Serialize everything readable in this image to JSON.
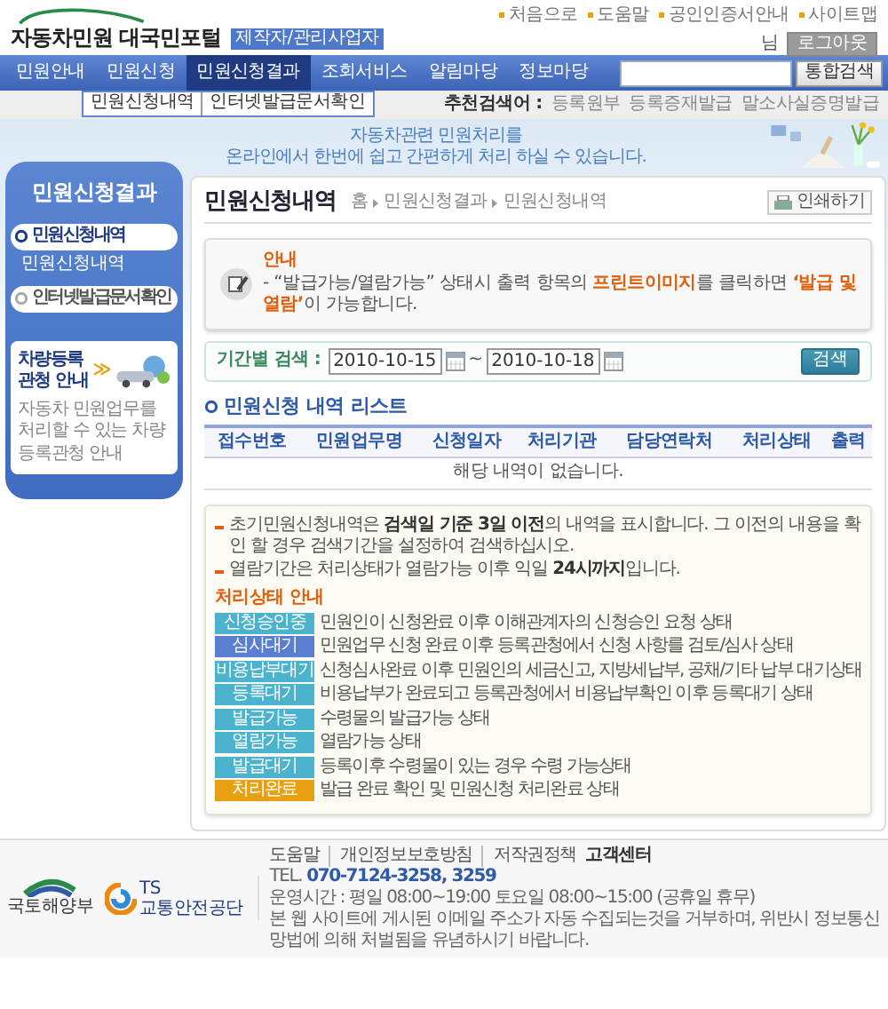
{
  "header": {
    "logo": "자동차민원 대국민포털",
    "logo_badge": "제작자/관리사업자",
    "top_links": [
      "처음으로",
      "도움말",
      "공인인증서안내",
      "사이트맵"
    ],
    "user_suffix": "님",
    "logout_button": "로그아웃"
  },
  "nav": {
    "tabs": [
      {
        "label": "민원안내",
        "selected": false
      },
      {
        "label": "민원신청",
        "selected": false
      },
      {
        "label": "민원신청결과",
        "selected": true
      },
      {
        "label": "조회서비스",
        "selected": false
      },
      {
        "label": "알림마당",
        "selected": false
      },
      {
        "label": "정보마당",
        "selected": false
      }
    ],
    "search_button": "통합검색"
  },
  "submenu": [
    "민원신청내역",
    "인터넷발급문서확인"
  ],
  "recommended": {
    "label": "추천검색어 :",
    "terms": [
      "등록원부",
      "등록증재발급",
      "말소사실증명발급"
    ]
  },
  "banner": {
    "lines": [
      "자동차관련 민원처리를",
      "온라인에서 한번에 쉽고 간편하게 처리 하실 수 있습니다."
    ]
  },
  "sidebar": {
    "title": "민원신청결과",
    "items": [
      {
        "label": "민원신청내역",
        "selected": true,
        "expanded": true,
        "children": [
          {
            "label": "민원신청내역",
            "selected": true
          }
        ]
      },
      {
        "label": "인터넷발급문서확인",
        "selected": false,
        "expanded": false
      }
    ],
    "ad": {
      "title": "차량등록 관청 안내",
      "arrow": "≫",
      "text": "자동차 민원업무를 처리할 수 있는 차량등록관청 안내"
    }
  },
  "content": {
    "title": "민원신청내역",
    "breadcrumb": [
      "홈",
      "민원신청결과",
      "민원신청내역"
    ],
    "print_button": "인쇄하기",
    "notice": {
      "title": "안내",
      "text": "- “발급가능/열람가능” 상태시 출력 항목의 **프린트이미지**를 클릭하면 **‘발급 및 열람’**이 가능합니다."
    },
    "search": {
      "label": "기간별 검색 :",
      "date_from": "2010-10-15",
      "separator": "~",
      "date_to": "2010-10-18",
      "button": "검색"
    },
    "list_title": "민원신청 내역 리스트",
    "table": {
      "columns": [
        "접수번호",
        "민원업무명",
        "신청일자",
        "처리기관",
        "담당연락처",
        "처리상태",
        "출력"
      ],
      "empty_message": "해당 내역이 없습니다."
    },
    "info": {
      "bullets": [
        "초기민원신청내역은 **검색일 기준 3일 이전**의 내역을 표시합니다. 그 이전의 내용을 확인 할 경우 검색기간을 설정하여 검색하십시오.",
        "열람기간은 처리상태가 열람가능 이후 익일 **24시까지**입니다."
      ],
      "status_title": "처리상태 안내",
      "statuses": [
        {
          "label": "신청승인중",
          "text": "민원인이 신청완료 이후 이해관계자의 신청승인 요청 상태",
          "color": "#4cb3cf"
        },
        {
          "label": "심사대기",
          "text": "민원업무 신청 완료 이후 등록관청에서 신청 사항를 검토/심사 상태",
          "color": "#5b7fd0"
        },
        {
          "label": "비용납부대기",
          "text": "신청심사완료 이후 민원인의 세금신고, 지방세납부, 공채/기타 납부 대기상태",
          "color": "#4cb3cf"
        },
        {
          "label": "등록대기",
          "text": "비용납부가 완료되고 등록관청에서 비용납부확인 이후 등록대기 상태",
          "color": "#4cb3cf"
        },
        {
          "label": "발급가능",
          "text": "수령물의 발급가능 상태",
          "color": "#4cb3cf"
        },
        {
          "label": "열람가능",
          "text": "열람가능 상태",
          "color": "#4cb3cf"
        },
        {
          "label": "발급대기",
          "text": "등록이후 수령물이 있는 경우 수령 가능상태",
          "color": "#4cb3cf"
        },
        {
          "label": "처리완료",
          "text": "발급 완료 확인 및 민원신청 처리완료 상태",
          "color": "#e8a013"
        }
      ]
    }
  },
  "footer": {
    "logos": [
      "국토해양부",
      "TS",
      "교통안전공단"
    ],
    "links": [
      "도움말",
      "개인정보보호방침",
      "저작권정책"
    ],
    "customer_center": "고객센터",
    "phone": "TEL. **070-7124-3258, 3259**",
    "hours": "운영시간 : 평일 08:00~19:00 토요일 08:00~15:00 (공휴일 휴무)",
    "disclaimer": "본 웹 사이트에 게시된 이메일 주소가 자동 수집되는것을 거부하며, 위반시 정보통신망법에 의해 처벌됨을 유념하시기 바랍니다."
  }
}
